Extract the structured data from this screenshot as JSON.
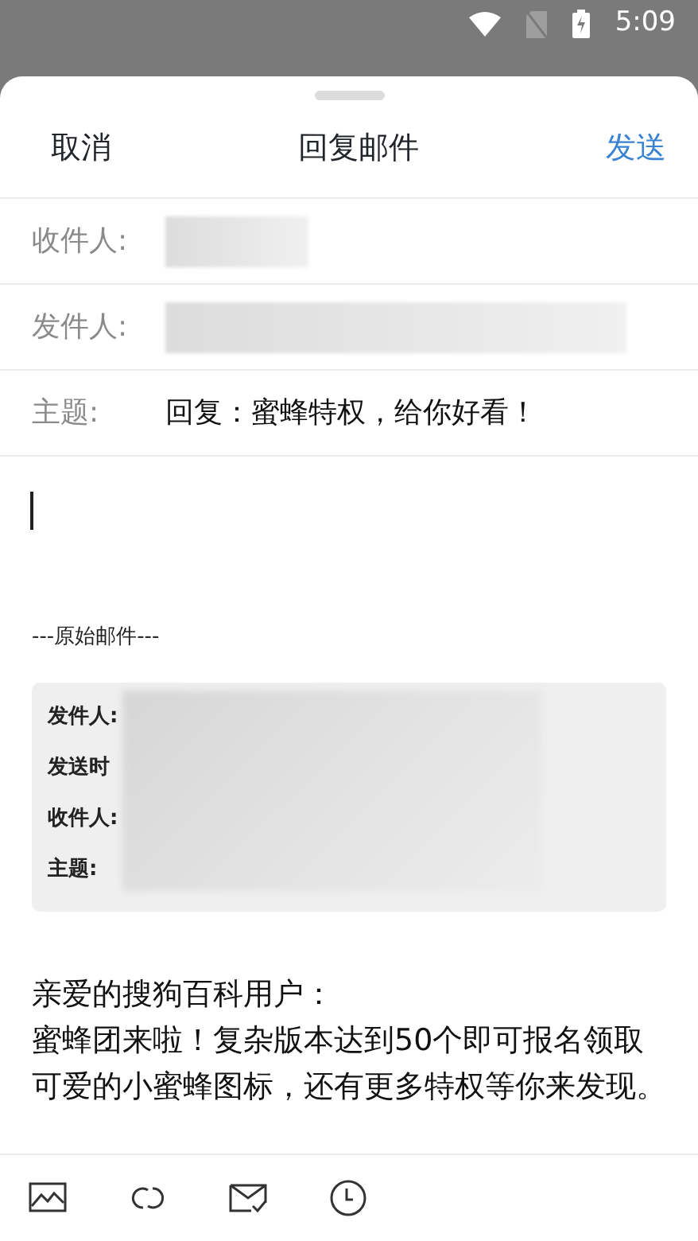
{
  "status_bar": {
    "time": "5:09"
  },
  "header": {
    "cancel": "取消",
    "title": "回复邮件",
    "send": "发送"
  },
  "fields": [
    {
      "label": "收件人:",
      "kind": "blurred"
    },
    {
      "label": "发件人:",
      "kind": "blurred"
    },
    {
      "label": "主题:",
      "kind": "text",
      "value": "回复：蜜蜂特权，给你好看！"
    }
  ],
  "separator": "---原始邮件---",
  "quoted": {
    "rows": [
      {
        "label": "发件人:"
      },
      {
        "label": "发送时"
      },
      {
        "label": "收件人:"
      },
      {
        "label": "主题:"
      }
    ]
  },
  "body": {
    "greeting": "亲爱的搜狗百科用户：",
    "text": "蜜蜂团来啦！复杂版本达到50个即可报名领取可爱的小蜜蜂图标，还有更多特权等你来发现。"
  },
  "toolbar": [
    {
      "kind": "image"
    },
    {
      "kind": "link"
    },
    {
      "kind": "receipt"
    },
    {
      "kind": "clock"
    }
  ]
}
